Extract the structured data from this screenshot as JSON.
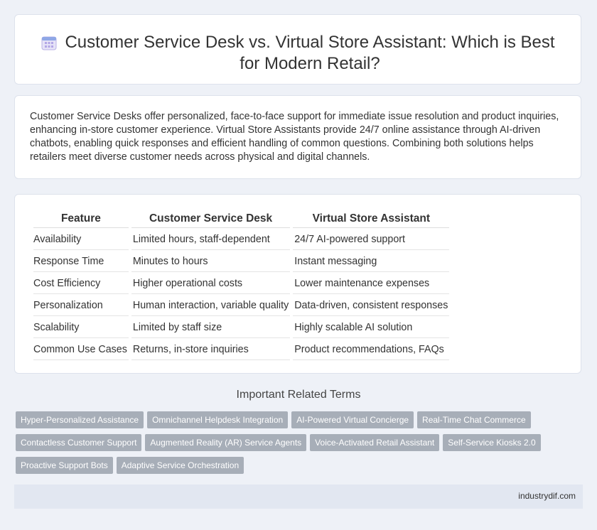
{
  "header": {
    "icon": "calendar-icon",
    "title": "Customer Service Desk vs. Virtual Store Assistant: Which is Best for Modern Retail?"
  },
  "intro": {
    "text": "Customer Service Desks offer personalized, face-to-face support for immediate issue resolution and product inquiries, enhancing in-store customer experience. Virtual Store Assistants provide 24/7 online assistance through AI-driven chatbots, enabling quick responses and efficient handling of common questions. Combining both solutions helps retailers meet diverse customer needs across physical and digital channels."
  },
  "table": {
    "headers": [
      "Feature",
      "Customer Service Desk",
      "Virtual Store Assistant"
    ],
    "rows": [
      [
        "Availability",
        "Limited hours, staff-dependent",
        "24/7 AI-powered support"
      ],
      [
        "Response Time",
        "Minutes to hours",
        "Instant messaging"
      ],
      [
        "Cost Efficiency",
        "Higher operational costs",
        "Lower maintenance expenses"
      ],
      [
        "Personalization",
        "Human interaction, variable quality",
        "Data-driven, consistent responses"
      ],
      [
        "Scalability",
        "Limited by staff size",
        "Highly scalable AI solution"
      ],
      [
        "Common Use Cases",
        "Returns, in-store inquiries",
        "Product recommendations, FAQs"
      ]
    ]
  },
  "related": {
    "title": "Important Related Terms",
    "tags": [
      "Hyper-Personalized Assistance",
      "Omnichannel Helpdesk Integration",
      "AI-Powered Virtual Concierge",
      "Real-Time Chat Commerce",
      "Contactless Customer Support",
      "Augmented Reality (AR) Service Agents",
      "Voice-Activated Retail Assistant",
      "Self-Service Kiosks 2.0",
      "Proactive Support Bots",
      "Adaptive Service Orchestration"
    ]
  },
  "footer": {
    "site": "industrydif.com"
  },
  "colors": {
    "background": "#eef1f7",
    "tag": "#a7aeb8",
    "footer": "#e2e7f1"
  }
}
